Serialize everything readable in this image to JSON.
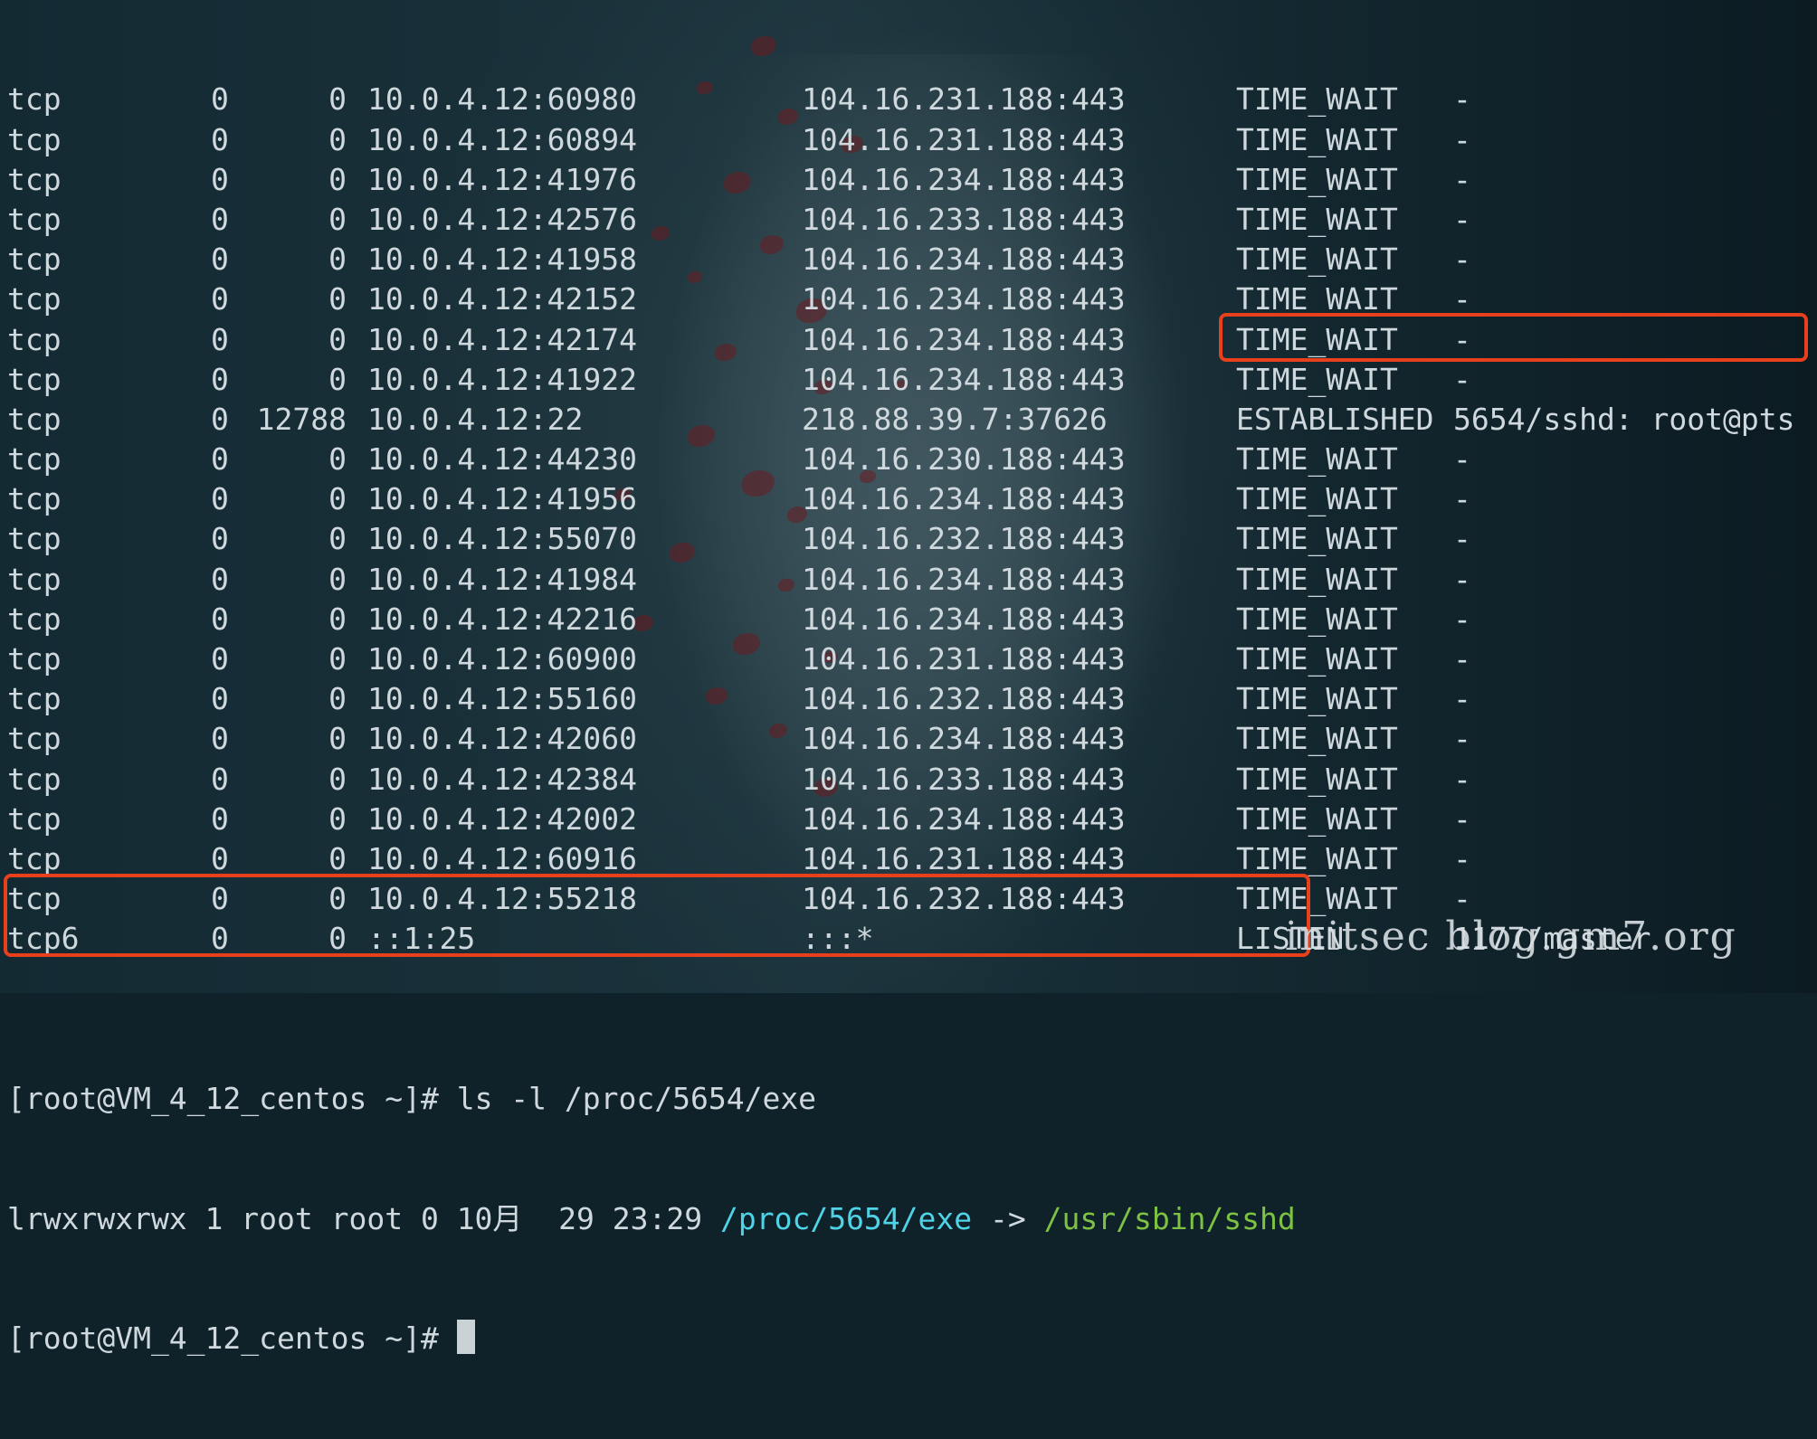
{
  "netstat_rows": [
    {
      "proto": "tcp",
      "recv": "0",
      "send": "0",
      "local": "10.0.4.12:60980",
      "foreign": "104.16.231.188:443",
      "state": "TIME_WAIT",
      "pid": "-"
    },
    {
      "proto": "tcp",
      "recv": "0",
      "send": "0",
      "local": "10.0.4.12:60894",
      "foreign": "104.16.231.188:443",
      "state": "TIME_WAIT",
      "pid": "-"
    },
    {
      "proto": "tcp",
      "recv": "0",
      "send": "0",
      "local": "10.0.4.12:41976",
      "foreign": "104.16.234.188:443",
      "state": "TIME_WAIT",
      "pid": "-"
    },
    {
      "proto": "tcp",
      "recv": "0",
      "send": "0",
      "local": "10.0.4.12:42576",
      "foreign": "104.16.233.188:443",
      "state": "TIME_WAIT",
      "pid": "-"
    },
    {
      "proto": "tcp",
      "recv": "0",
      "send": "0",
      "local": "10.0.4.12:41958",
      "foreign": "104.16.234.188:443",
      "state": "TIME_WAIT",
      "pid": "-"
    },
    {
      "proto": "tcp",
      "recv": "0",
      "send": "0",
      "local": "10.0.4.12:42152",
      "foreign": "104.16.234.188:443",
      "state": "TIME_WAIT",
      "pid": "-"
    },
    {
      "proto": "tcp",
      "recv": "0",
      "send": "0",
      "local": "10.0.4.12:42174",
      "foreign": "104.16.234.188:443",
      "state": "TIME_WAIT",
      "pid": "-"
    },
    {
      "proto": "tcp",
      "recv": "0",
      "send": "0",
      "local": "10.0.4.12:41922",
      "foreign": "104.16.234.188:443",
      "state": "TIME_WAIT",
      "pid": "-"
    },
    {
      "proto": "tcp",
      "recv": "0",
      "send": "12788",
      "local": "10.0.4.12:22",
      "foreign": "218.88.39.7:37626",
      "state": "ESTABLISHED",
      "pid": "5654/sshd: root@pts"
    },
    {
      "proto": "tcp",
      "recv": "0",
      "send": "0",
      "local": "10.0.4.12:44230",
      "foreign": "104.16.230.188:443",
      "state": "TIME_WAIT",
      "pid": "-"
    },
    {
      "proto": "tcp",
      "recv": "0",
      "send": "0",
      "local": "10.0.4.12:41956",
      "foreign": "104.16.234.188:443",
      "state": "TIME_WAIT",
      "pid": "-"
    },
    {
      "proto": "tcp",
      "recv": "0",
      "send": "0",
      "local": "10.0.4.12:55070",
      "foreign": "104.16.232.188:443",
      "state": "TIME_WAIT",
      "pid": "-"
    },
    {
      "proto": "tcp",
      "recv": "0",
      "send": "0",
      "local": "10.0.4.12:41984",
      "foreign": "104.16.234.188:443",
      "state": "TIME_WAIT",
      "pid": "-"
    },
    {
      "proto": "tcp",
      "recv": "0",
      "send": "0",
      "local": "10.0.4.12:42216",
      "foreign": "104.16.234.188:443",
      "state": "TIME_WAIT",
      "pid": "-"
    },
    {
      "proto": "tcp",
      "recv": "0",
      "send": "0",
      "local": "10.0.4.12:60900",
      "foreign": "104.16.231.188:443",
      "state": "TIME_WAIT",
      "pid": "-"
    },
    {
      "proto": "tcp",
      "recv": "0",
      "send": "0",
      "local": "10.0.4.12:55160",
      "foreign": "104.16.232.188:443",
      "state": "TIME_WAIT",
      "pid": "-"
    },
    {
      "proto": "tcp",
      "recv": "0",
      "send": "0",
      "local": "10.0.4.12:42060",
      "foreign": "104.16.234.188:443",
      "state": "TIME_WAIT",
      "pid": "-"
    },
    {
      "proto": "tcp",
      "recv": "0",
      "send": "0",
      "local": "10.0.4.12:42384",
      "foreign": "104.16.233.188:443",
      "state": "TIME_WAIT",
      "pid": "-"
    },
    {
      "proto": "tcp",
      "recv": "0",
      "send": "0",
      "local": "10.0.4.12:42002",
      "foreign": "104.16.234.188:443",
      "state": "TIME_WAIT",
      "pid": "-"
    },
    {
      "proto": "tcp",
      "recv": "0",
      "send": "0",
      "local": "10.0.4.12:60916",
      "foreign": "104.16.231.188:443",
      "state": "TIME_WAIT",
      "pid": "-"
    },
    {
      "proto": "tcp",
      "recv": "0",
      "send": "0",
      "local": "10.0.4.12:55218",
      "foreign": "104.16.232.188:443",
      "state": "TIME_WAIT",
      "pid": "-"
    },
    {
      "proto": "tcp6",
      "recv": "0",
      "send": "0",
      "local": "::1:25",
      "foreign": ":::*",
      "state": "LISTEN",
      "pid": "1177/master"
    }
  ],
  "command": {
    "prompt": "[root@VM_4_12_centos ~]#",
    "text": " ls -l /proc/5654/exe"
  },
  "ls_output": {
    "perms": "lrwxrwxrwx 1 root root 0 10月  29 23:29 ",
    "link": "/proc/5654/exe",
    "arrow": " -> ",
    "target": "/usr/sbin/sshd"
  },
  "final_prompt": "[root@VM_4_12_centos ~]# ",
  "watermark": "initsec blog.gm7.org",
  "colors": {
    "highlight_border": "#e8401c",
    "link_cyan": "#4fd3e6",
    "target_green": "#7dc243",
    "text": "#cfd8dc"
  }
}
